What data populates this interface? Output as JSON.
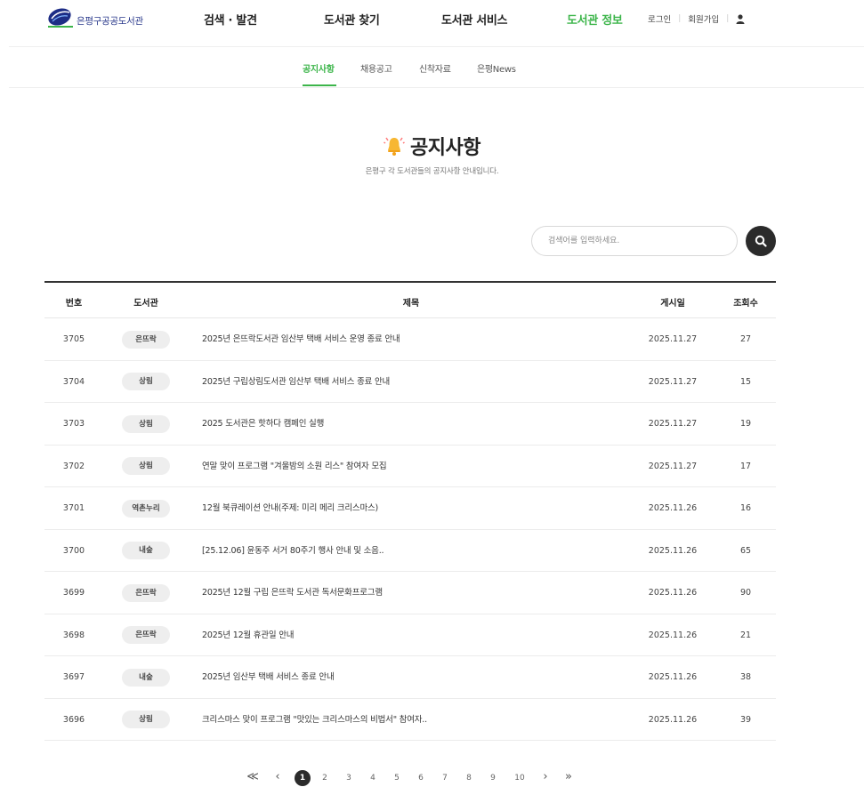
{
  "header": {
    "logo_text": "은평구공공도서관",
    "nav": [
      "검색 · 발견",
      "도서관 찾기",
      "도서관 서비스",
      "도서관 정보"
    ],
    "active_nav": "도서관 정보",
    "util": {
      "login": "로그인",
      "signup": "회원가입",
      "user_icon": "user-icon"
    }
  },
  "subnav": {
    "items": [
      "공지사항",
      "채용공고",
      "신착자료",
      "은평News"
    ],
    "active": "공지사항"
  },
  "page": {
    "title": "공지사항",
    "title_icon": "bell-icon",
    "subtitle": "은평구 각 도서관들의 공지사항 안내입니다."
  },
  "search": {
    "placeholder": "검색어를 입력하세요.",
    "value": "",
    "button_icon": "search-icon"
  },
  "table": {
    "headers": {
      "num": "번호",
      "lib": "도서관",
      "title": "제목",
      "date": "게시일",
      "views": "조회수"
    },
    "rows": [
      {
        "num": "3705",
        "lib": "은뜨락",
        "title": "2025년 은뜨락도서관 임산부 택배 서비스 운영 종료 안내",
        "date": "2025.11.27",
        "views": "27"
      },
      {
        "num": "3704",
        "lib": "상림",
        "title": "2025년 구립상림도서관 임산부 택배 서비스 종료 안내",
        "date": "2025.11.27",
        "views": "15"
      },
      {
        "num": "3703",
        "lib": "상림",
        "title": "2025 도서관은 핫하다 캠페인 실행",
        "date": "2025.11.27",
        "views": "19"
      },
      {
        "num": "3702",
        "lib": "상림",
        "title": "연말 맞이 프로그램 \"겨울밤의 소원 리스\" 참여자 모집",
        "date": "2025.11.27",
        "views": "17"
      },
      {
        "num": "3701",
        "lib": "역촌누리",
        "title": "12월 북큐레이션 안내(주제: 미리 메리 크리스마스)",
        "date": "2025.11.26",
        "views": "16"
      },
      {
        "num": "3700",
        "lib": "내숲",
        "title": "[25.12.06] 윤동주 서거 80주기 행사 안내 및 소음..",
        "date": "2025.11.26",
        "views": "65"
      },
      {
        "num": "3699",
        "lib": "은뜨락",
        "title": "2025년 12월 구립 은뜨락 도서관 독서문화프로그램",
        "date": "2025.11.26",
        "views": "90"
      },
      {
        "num": "3698",
        "lib": "은뜨락",
        "title": "2025년 12월 휴관일 안내",
        "date": "2025.11.26",
        "views": "21"
      },
      {
        "num": "3697",
        "lib": "내숲",
        "title": "2025년 임산부 택배 서비스 종료 안내",
        "date": "2025.11.26",
        "views": "38"
      },
      {
        "num": "3696",
        "lib": "상림",
        "title": "크리스마스 맞이 프로그램 \"맛있는 크리스마스의 비법서\" 참여자..",
        "date": "2025.11.26",
        "views": "39"
      }
    ]
  },
  "pagination": {
    "first": "≪",
    "prev": "‹",
    "pages": [
      "1",
      "2",
      "3",
      "4",
      "5",
      "6",
      "7",
      "8",
      "9",
      "10"
    ],
    "current": "1",
    "next": "›",
    "last": "»"
  },
  "colors": {
    "accent": "#3cb54a",
    "dark": "#2b2b2b",
    "badge_bg": "#eeeeee",
    "logo": "#2b3a8c"
  }
}
